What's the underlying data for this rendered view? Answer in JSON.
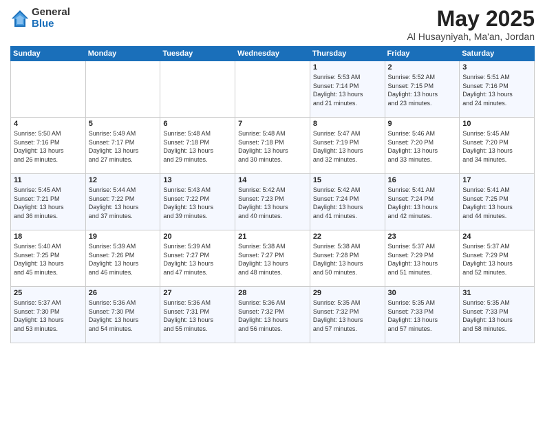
{
  "logo": {
    "general": "General",
    "blue": "Blue"
  },
  "title": "May 2025",
  "location": "Al Husayniyah, Ma'an, Jordan",
  "days_of_week": [
    "Sunday",
    "Monday",
    "Tuesday",
    "Wednesday",
    "Thursday",
    "Friday",
    "Saturday"
  ],
  "weeks": [
    [
      {
        "day": "",
        "text": ""
      },
      {
        "day": "",
        "text": ""
      },
      {
        "day": "",
        "text": ""
      },
      {
        "day": "",
        "text": ""
      },
      {
        "day": "1",
        "text": "Sunrise: 5:53 AM\nSunset: 7:14 PM\nDaylight: 13 hours\nand 21 minutes."
      },
      {
        "day": "2",
        "text": "Sunrise: 5:52 AM\nSunset: 7:15 PM\nDaylight: 13 hours\nand 23 minutes."
      },
      {
        "day": "3",
        "text": "Sunrise: 5:51 AM\nSunset: 7:16 PM\nDaylight: 13 hours\nand 24 minutes."
      }
    ],
    [
      {
        "day": "4",
        "text": "Sunrise: 5:50 AM\nSunset: 7:16 PM\nDaylight: 13 hours\nand 26 minutes."
      },
      {
        "day": "5",
        "text": "Sunrise: 5:49 AM\nSunset: 7:17 PM\nDaylight: 13 hours\nand 27 minutes."
      },
      {
        "day": "6",
        "text": "Sunrise: 5:48 AM\nSunset: 7:18 PM\nDaylight: 13 hours\nand 29 minutes."
      },
      {
        "day": "7",
        "text": "Sunrise: 5:48 AM\nSunset: 7:18 PM\nDaylight: 13 hours\nand 30 minutes."
      },
      {
        "day": "8",
        "text": "Sunrise: 5:47 AM\nSunset: 7:19 PM\nDaylight: 13 hours\nand 32 minutes."
      },
      {
        "day": "9",
        "text": "Sunrise: 5:46 AM\nSunset: 7:20 PM\nDaylight: 13 hours\nand 33 minutes."
      },
      {
        "day": "10",
        "text": "Sunrise: 5:45 AM\nSunset: 7:20 PM\nDaylight: 13 hours\nand 34 minutes."
      }
    ],
    [
      {
        "day": "11",
        "text": "Sunrise: 5:45 AM\nSunset: 7:21 PM\nDaylight: 13 hours\nand 36 minutes."
      },
      {
        "day": "12",
        "text": "Sunrise: 5:44 AM\nSunset: 7:22 PM\nDaylight: 13 hours\nand 37 minutes."
      },
      {
        "day": "13",
        "text": "Sunrise: 5:43 AM\nSunset: 7:22 PM\nDaylight: 13 hours\nand 39 minutes."
      },
      {
        "day": "14",
        "text": "Sunrise: 5:42 AM\nSunset: 7:23 PM\nDaylight: 13 hours\nand 40 minutes."
      },
      {
        "day": "15",
        "text": "Sunrise: 5:42 AM\nSunset: 7:24 PM\nDaylight: 13 hours\nand 41 minutes."
      },
      {
        "day": "16",
        "text": "Sunrise: 5:41 AM\nSunset: 7:24 PM\nDaylight: 13 hours\nand 42 minutes."
      },
      {
        "day": "17",
        "text": "Sunrise: 5:41 AM\nSunset: 7:25 PM\nDaylight: 13 hours\nand 44 minutes."
      }
    ],
    [
      {
        "day": "18",
        "text": "Sunrise: 5:40 AM\nSunset: 7:25 PM\nDaylight: 13 hours\nand 45 minutes."
      },
      {
        "day": "19",
        "text": "Sunrise: 5:39 AM\nSunset: 7:26 PM\nDaylight: 13 hours\nand 46 minutes."
      },
      {
        "day": "20",
        "text": "Sunrise: 5:39 AM\nSunset: 7:27 PM\nDaylight: 13 hours\nand 47 minutes."
      },
      {
        "day": "21",
        "text": "Sunrise: 5:38 AM\nSunset: 7:27 PM\nDaylight: 13 hours\nand 48 minutes."
      },
      {
        "day": "22",
        "text": "Sunrise: 5:38 AM\nSunset: 7:28 PM\nDaylight: 13 hours\nand 50 minutes."
      },
      {
        "day": "23",
        "text": "Sunrise: 5:37 AM\nSunset: 7:29 PM\nDaylight: 13 hours\nand 51 minutes."
      },
      {
        "day": "24",
        "text": "Sunrise: 5:37 AM\nSunset: 7:29 PM\nDaylight: 13 hours\nand 52 minutes."
      }
    ],
    [
      {
        "day": "25",
        "text": "Sunrise: 5:37 AM\nSunset: 7:30 PM\nDaylight: 13 hours\nand 53 minutes."
      },
      {
        "day": "26",
        "text": "Sunrise: 5:36 AM\nSunset: 7:30 PM\nDaylight: 13 hours\nand 54 minutes."
      },
      {
        "day": "27",
        "text": "Sunrise: 5:36 AM\nSunset: 7:31 PM\nDaylight: 13 hours\nand 55 minutes."
      },
      {
        "day": "28",
        "text": "Sunrise: 5:36 AM\nSunset: 7:32 PM\nDaylight: 13 hours\nand 56 minutes."
      },
      {
        "day": "29",
        "text": "Sunrise: 5:35 AM\nSunset: 7:32 PM\nDaylight: 13 hours\nand 57 minutes."
      },
      {
        "day": "30",
        "text": "Sunrise: 5:35 AM\nSunset: 7:33 PM\nDaylight: 13 hours\nand 57 minutes."
      },
      {
        "day": "31",
        "text": "Sunrise: 5:35 AM\nSunset: 7:33 PM\nDaylight: 13 hours\nand 58 minutes."
      }
    ]
  ]
}
